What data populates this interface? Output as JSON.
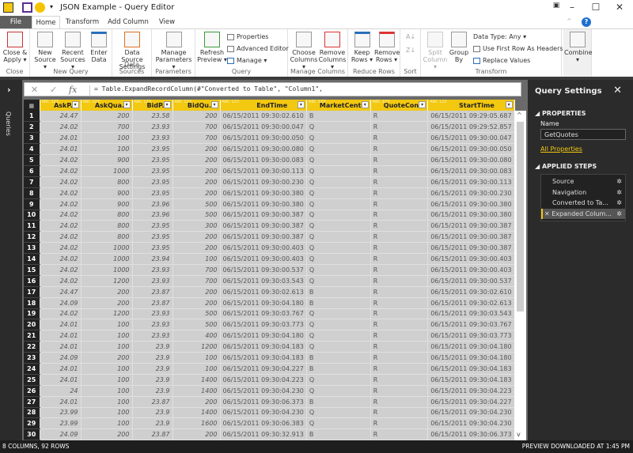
{
  "window": {
    "title": "JSON Example - Query Editor"
  },
  "tabs": [
    "File",
    "Home",
    "Transform",
    "Add Column",
    "View"
  ],
  "ribbon": {
    "close": {
      "group": "Close",
      "buttons": [
        [
          "Close &",
          "Apply ▾"
        ]
      ]
    },
    "new_query": {
      "group": "New Query",
      "buttons": [
        [
          "New",
          "Source ▾"
        ],
        [
          "Recent",
          "Sources ▾"
        ],
        [
          "Enter",
          "Data"
        ]
      ]
    },
    "data_sources": {
      "group": "Data Sources",
      "buttons": [
        [
          "Data Source",
          "Settings"
        ]
      ]
    },
    "parameters": {
      "group": "Parameters",
      "buttons": [
        [
          "Manage",
          "Parameters ▾"
        ]
      ]
    },
    "query": {
      "group": "Query",
      "refresh": [
        "Refresh",
        "Preview ▾"
      ],
      "small": [
        "Properties",
        "Advanced Editor",
        "Manage ▾"
      ]
    },
    "manage_columns": {
      "group": "Manage Columns",
      "buttons": [
        [
          "Choose",
          "Columns ▾"
        ],
        [
          "Remove",
          "Columns ▾"
        ]
      ]
    },
    "reduce_rows": {
      "group": "Reduce Rows",
      "buttons": [
        [
          "Keep",
          "Rows ▾"
        ],
        [
          "Remove",
          "Rows ▾"
        ]
      ]
    },
    "sort": {
      "group": "Sort"
    },
    "transform": {
      "group": "Transform",
      "buttons": [
        [
          "Split",
          "Column ▾"
        ],
        [
          "Group",
          "By"
        ]
      ],
      "small": [
        "Data Type: Any ▾",
        "Use First Row As Headers ▾",
        "Replace Values"
      ]
    },
    "combine": {
      "buttons": [
        [
          "Combine",
          "▾"
        ]
      ]
    }
  },
  "queries_pane": {
    "label": "Queries"
  },
  "formula": "= Table.ExpandRecordColumn(#\"Converted to Table\", \"Column1\",",
  "grid": {
    "columns": [
      "AskP...",
      "AskQua...",
      "BidP...",
      "BidQu...",
      "EndTime",
      "MarketCenter",
      "QuoteCon...",
      "StartTime"
    ],
    "type_icon": "ABC 123",
    "rows": [
      [
        "24.47",
        "200",
        "23.58",
        "200",
        "06/15/2011 09:30:02.610",
        "B",
        "R",
        "06/15/2011 09:29:05.687"
      ],
      [
        "24.02",
        "700",
        "23.93",
        "700",
        "06/15/2011 09:30:00.047",
        "Q",
        "R",
        "06/15/2011 09:29:52.857"
      ],
      [
        "24.01",
        "100",
        "23.93",
        "700",
        "06/15/2011 09:30:00.050",
        "Q",
        "R",
        "06/15/2011 09:30:00.047"
      ],
      [
        "24.01",
        "100",
        "23.95",
        "200",
        "06/15/2011 09:30:00.080",
        "Q",
        "R",
        "06/15/2011 09:30:00.050"
      ],
      [
        "24.02",
        "900",
        "23.95",
        "200",
        "06/15/2011 09:30:00.083",
        "Q",
        "R",
        "06/15/2011 09:30:00.080"
      ],
      [
        "24.02",
        "1000",
        "23.95",
        "200",
        "06/15/2011 09:30:00.113",
        "Q",
        "R",
        "06/15/2011 09:30:00.083"
      ],
      [
        "24.02",
        "800",
        "23.95",
        "200",
        "06/15/2011 09:30:00.230",
        "Q",
        "R",
        "06/15/2011 09:30:00.113"
      ],
      [
        "24.02",
        "900",
        "23.95",
        "200",
        "06/15/2011 09:30:00.380",
        "Q",
        "R",
        "06/15/2011 09:30:00.230"
      ],
      [
        "24.02",
        "900",
        "23.96",
        "500",
        "06/15/2011 09:30:00.380",
        "Q",
        "R",
        "06/15/2011 09:30:00.380"
      ],
      [
        "24.02",
        "800",
        "23.96",
        "500",
        "06/15/2011 09:30:00.387",
        "Q",
        "R",
        "06/15/2011 09:30:00.380"
      ],
      [
        "24.02",
        "800",
        "23.95",
        "300",
        "06/15/2011 09:30:00.387",
        "Q",
        "R",
        "06/15/2011 09:30:00.387"
      ],
      [
        "24.02",
        "800",
        "23.95",
        "200",
        "06/15/2011 09:30:00.387",
        "Q",
        "R",
        "06/15/2011 09:30:00.387"
      ],
      [
        "24.02",
        "1000",
        "23.95",
        "200",
        "06/15/2011 09:30:00.403",
        "Q",
        "R",
        "06/15/2011 09:30:00.387"
      ],
      [
        "24.02",
        "1000",
        "23.94",
        "100",
        "06/15/2011 09:30:00.403",
        "Q",
        "R",
        "06/15/2011 09:30:00.403"
      ],
      [
        "24.02",
        "1000",
        "23.93",
        "700",
        "06/15/2011 09:30:00.537",
        "Q",
        "R",
        "06/15/2011 09:30:00.403"
      ],
      [
        "24.02",
        "1200",
        "23.93",
        "700",
        "06/15/2011 09:30:03.543",
        "Q",
        "R",
        "06/15/2011 09:30:00.537"
      ],
      [
        "24.47",
        "200",
        "23.87",
        "200",
        "06/15/2011 09:30:02.613",
        "B",
        "R",
        "06/15/2011 09:30:02.610"
      ],
      [
        "24.09",
        "200",
        "23.87",
        "200",
        "06/15/2011 09:30:04.180",
        "B",
        "R",
        "06/15/2011 09:30:02.613"
      ],
      [
        "24.02",
        "1200",
        "23.93",
        "500",
        "06/15/2011 09:30:03.767",
        "Q",
        "R",
        "06/15/2011 09:30:03.543"
      ],
      [
        "24.01",
        "100",
        "23.93",
        "500",
        "06/15/2011 09:30:03.773",
        "Q",
        "R",
        "06/15/2011 09:30:03.767"
      ],
      [
        "24.01",
        "100",
        "23.93",
        "400",
        "06/15/2011 09:30:04.180",
        "Q",
        "R",
        "06/15/2011 09:30:03.773"
      ],
      [
        "24.01",
        "100",
        "23.9",
        "1200",
        "06/15/2011 09:30:04.183",
        "Q",
        "R",
        "06/15/2011 09:30:04.180"
      ],
      [
        "24.09",
        "200",
        "23.9",
        "100",
        "06/15/2011 09:30:04.183",
        "B",
        "R",
        "06/15/2011 09:30:04.180"
      ],
      [
        "24.01",
        "100",
        "23.9",
        "100",
        "06/15/2011 09:30:04.227",
        "B",
        "R",
        "06/15/2011 09:30:04.183"
      ],
      [
        "24.01",
        "100",
        "23.9",
        "1400",
        "06/15/2011 09:30:04.223",
        "Q",
        "R",
        "06/15/2011 09:30:04.183"
      ],
      [
        "24",
        "100",
        "23.9",
        "1400",
        "06/15/2011 09:30:04.230",
        "Q",
        "R",
        "06/15/2011 09:30:04.223"
      ],
      [
        "24.01",
        "100",
        "23.87",
        "200",
        "06/15/2011 09:30:06.373",
        "B",
        "R",
        "06/15/2011 09:30:04.227"
      ],
      [
        "23.99",
        "100",
        "23.9",
        "1400",
        "06/15/2011 09:30:04.230",
        "Q",
        "R",
        "06/15/2011 09:30:04.230"
      ],
      [
        "23.99",
        "100",
        "23.9",
        "1600",
        "06/15/2011 09:30:06.383",
        "Q",
        "R",
        "06/15/2011 09:30:04.230"
      ],
      [
        "24.09",
        "200",
        "23.87",
        "200",
        "06/15/2011 09:30:32.913",
        "B",
        "R",
        "06/15/2011 09:30:06.373"
      ]
    ]
  },
  "query_settings": {
    "title": "Query Settings",
    "properties_label": "PROPERTIES",
    "name_label": "Name",
    "name_value": "GetQuotes",
    "all_properties": "All Properties",
    "applied_steps_label": "APPLIED STEPS",
    "steps": [
      "Source",
      "Navigation",
      "Converted to Ta...",
      "Expanded Colum..."
    ],
    "selected_step": 3
  },
  "status": {
    "left": "8 COLUMNS, 92 ROWS",
    "right": "PREVIEW DOWNLOADED AT 1:45 PM"
  },
  "colors": {
    "accent": "#f2c811",
    "pane": "#2b2b2b",
    "cell": "#cfcfcf"
  }
}
